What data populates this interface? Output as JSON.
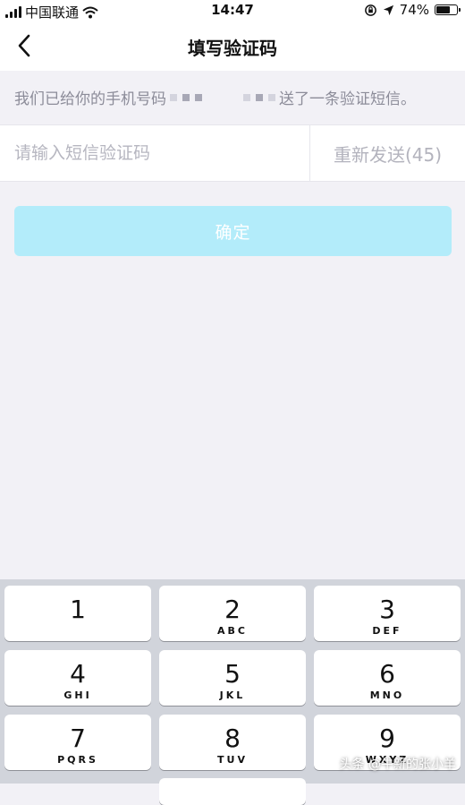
{
  "status_bar": {
    "carrier": "中国联通",
    "time": "14:47",
    "battery_percent": "74%",
    "battery_level": 0.74,
    "icons": [
      "signal-bars-icon",
      "wifi-icon",
      "orientation-lock-icon",
      "location-arrow-icon",
      "battery-icon"
    ]
  },
  "nav": {
    "title": "填写验证码",
    "back_icon": "chevron-left-icon"
  },
  "info": {
    "text_before": "我们已给你的手机号码",
    "text_after": "送了一条验证短信。"
  },
  "code_input": {
    "value": "",
    "placeholder": "请输入短信验证码"
  },
  "resend": {
    "label": "重新发送(45)"
  },
  "confirm": {
    "label": "确定",
    "color": "#b3ecfa"
  },
  "keyboard": {
    "keys": [
      {
        "num": "1",
        "letters": ""
      },
      {
        "num": "2",
        "letters": "ABC"
      },
      {
        "num": "3",
        "letters": "DEF"
      },
      {
        "num": "4",
        "letters": "GHI"
      },
      {
        "num": "5",
        "letters": "JKL"
      },
      {
        "num": "6",
        "letters": "MNO"
      },
      {
        "num": "7",
        "letters": "PQRS"
      },
      {
        "num": "8",
        "letters": "TUV"
      },
      {
        "num": "9",
        "letters": "WXYZ"
      }
    ]
  },
  "watermark": "头条 @牛新的张小羊"
}
